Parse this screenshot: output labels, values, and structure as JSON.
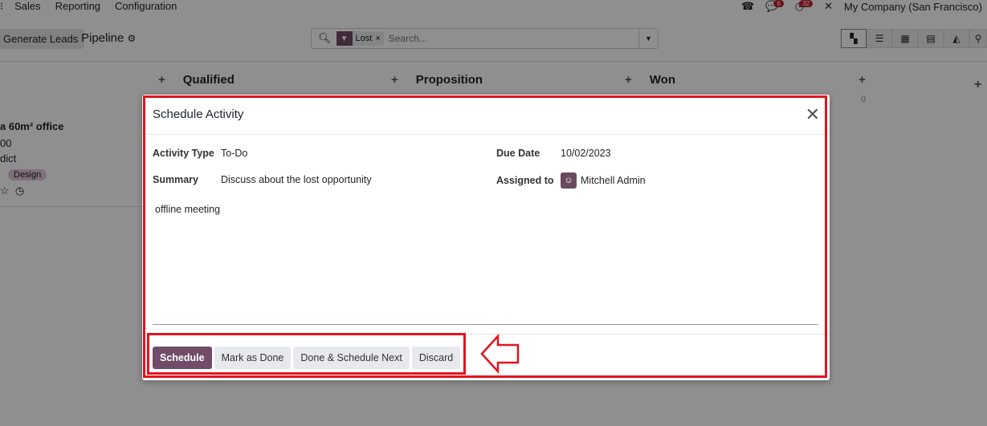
{
  "nav": {
    "menu": [
      "Sales",
      "Reporting",
      "Configuration"
    ],
    "company": "My Company (San Francisco)",
    "messages_count": "6",
    "activities_count": "32"
  },
  "control": {
    "generate_leads": "Generate Leads",
    "breadcrumb": "Pipeline",
    "facet": "Lost",
    "search_placeholder": "Search..."
  },
  "columns": [
    {
      "name": "Qualified"
    },
    {
      "name": "Proposition"
    },
    {
      "name": "Won"
    }
  ],
  "won_count": "0",
  "card": {
    "title": "a 60m² office",
    "amount": "00",
    "customer": "dict",
    "tag": "Design"
  },
  "modal": {
    "title": "Schedule Activity",
    "activity_type_label": "Activity Type",
    "activity_type": "To-Do",
    "summary_label": "Summary",
    "summary": "Discuss about the lost opportunity",
    "due_date_label": "Due Date",
    "due_date": "10/02/2023",
    "assigned_label": "Assigned to",
    "assigned": "Mitchell Admin",
    "note": "offline meeting",
    "buttons": {
      "schedule": "Schedule",
      "mark_done": "Mark as Done",
      "done_next": "Done & Schedule Next",
      "discard": "Discard"
    }
  },
  "colors": {
    "primary": "#714b67",
    "highlight": "#e3141f"
  }
}
